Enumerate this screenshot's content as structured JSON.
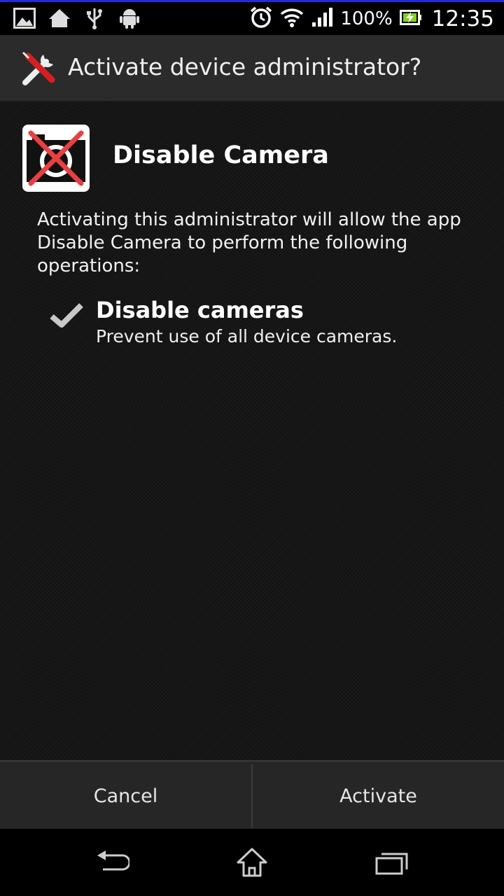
{
  "status_bar": {
    "battery_text": "100%",
    "clock": "12:35",
    "left_icons": [
      "gallery-icon",
      "home-notification-icon",
      "usb-icon",
      "android-icon"
    ],
    "right_icons": [
      "alarm-icon",
      "wifi-icon",
      "signal-icon",
      "battery-charging-icon"
    ]
  },
  "dialog": {
    "title": "Activate device administrator?",
    "title_icon": "tools-icon",
    "app_name": "Disable Camera",
    "app_icon": "disable-camera-app-icon",
    "description": "Activating this administrator will allow the app Disable Camera to perform the following operations:",
    "permissions": [
      {
        "title": "Disable cameras",
        "description": "Prevent use of all device cameras.",
        "icon": "check-icon"
      }
    ]
  },
  "buttons": {
    "cancel": "Cancel",
    "activate": "Activate"
  },
  "nav_bar": {
    "icons": [
      "back-icon",
      "home-icon",
      "recent-apps-icon"
    ]
  },
  "colors": {
    "accent_line": "#1a2fd8",
    "battery_fill": "#7fd21c",
    "wrench_handle": "#d42020"
  }
}
